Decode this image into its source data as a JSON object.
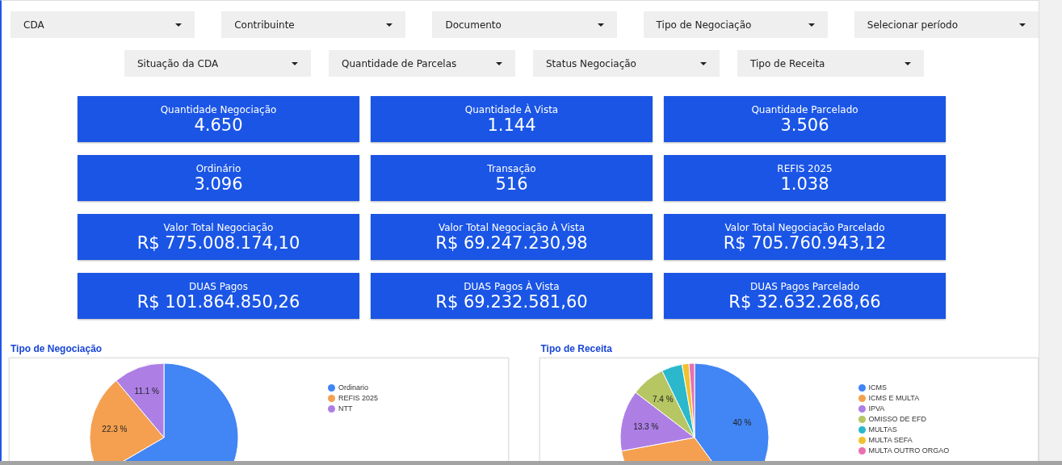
{
  "filters_row_1": [
    {
      "label": "CDA"
    },
    {
      "label": "Contribuinte"
    },
    {
      "label": "Documento"
    },
    {
      "label": "Tipo de Negociação"
    },
    {
      "label": "Selecionar período"
    }
  ],
  "filters_row_2": [
    {
      "label": "Situação da CDA"
    },
    {
      "label": "Quantidade de Parcelas"
    },
    {
      "label": "Status Negociação"
    },
    {
      "label": "Tipo de Receita"
    }
  ],
  "kpi_cards": [
    {
      "label": "Quantidade Negociação",
      "value": "4.650"
    },
    {
      "label": "Quantidade À Vista",
      "value": "1.144"
    },
    {
      "label": "Quantidade Parcelado",
      "value": "3.506"
    },
    {
      "label": "Ordinário",
      "value": "3.096"
    },
    {
      "label": "Transação",
      "value": "516"
    },
    {
      "label": "REFIS 2025",
      "value": "1.038"
    },
    {
      "label": "Valor Total Negociação",
      "value": "R$ 775.008.174,10"
    },
    {
      "label": "Valor Total Negociação À Vista",
      "value": "R$ 69.247.230,98"
    },
    {
      "label": "Valor Total Negociação Parcelado",
      "value": "R$ 705.760.943,12"
    },
    {
      "label": "DUAS Pagos",
      "value": "R$ 101.864.850,26"
    },
    {
      "label": "DUAS Pagos À Vista",
      "value": "R$ 69.232.581,60"
    },
    {
      "label": "DUAS Pagos Parcelado",
      "value": "R$ 32.632.268,66"
    }
  ],
  "charts": [
    {
      "chart_data": {
        "type": "pie",
        "title": "Tipo de Negociação",
        "categories": [
          "Ordinario",
          "REFIS 2025",
          "NTT"
        ],
        "values": [
          66.6,
          22.3,
          11.1
        ],
        "colors": [
          "#4285f4",
          "#f4a050",
          "#ad7fe5"
        ],
        "value_labels": [
          null,
          "22.3 %",
          "11.1 %"
        ],
        "legend": "right"
      }
    },
    {
      "chart_data": {
        "type": "pie",
        "title": "Tipo de Receita",
        "categories": [
          "ICMS",
          "ICMS E MULTA",
          "IPVA",
          "OMISSO DE EFD",
          "MULTAS",
          "MULTA SEFA",
          "MULTA OUTRO ORGAO"
        ],
        "values": [
          40,
          32.1,
          13.3,
          7.4,
          4.5,
          1.5,
          1.2
        ],
        "colors": [
          "#4285f4",
          "#f4a050",
          "#ad7fe5",
          "#b5c663",
          "#2bb8cc",
          "#f2c12e",
          "#e870b0"
        ],
        "value_labels": [
          "40 %",
          null,
          "13.3 %",
          "7.4 %",
          null,
          null,
          null
        ],
        "legend": "right"
      }
    }
  ]
}
